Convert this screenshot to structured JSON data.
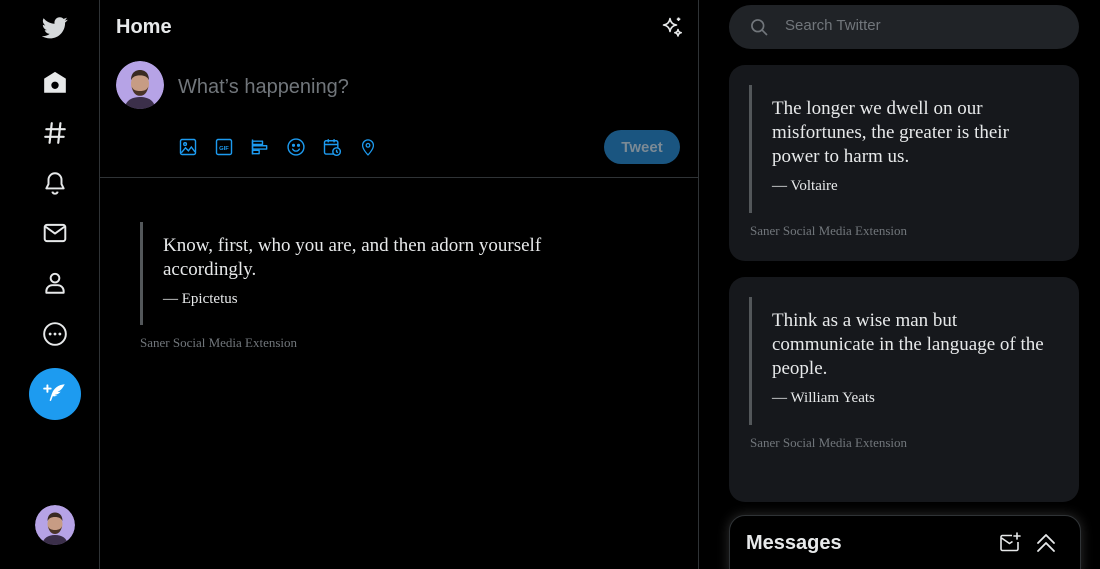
{
  "nav": {
    "items": [
      {
        "name": "twitter-logo-icon"
      },
      {
        "name": "home-icon"
      },
      {
        "name": "explore-hashtag-icon"
      },
      {
        "name": "notifications-bell-icon"
      },
      {
        "name": "messages-envelope-icon"
      },
      {
        "name": "profile-person-icon"
      },
      {
        "name": "more-circle-icon"
      }
    ],
    "compose_icon": "compose-feather-icon",
    "accent_color": "#1d9bf0"
  },
  "header": {
    "title": "Home",
    "sparkle_icon": "sparkle-icon"
  },
  "composer": {
    "placeholder": "What’s happening?",
    "tools": [
      "image-icon",
      "gif-icon",
      "poll-icon",
      "emoji-icon",
      "schedule-icon",
      "location-icon"
    ],
    "gif_label": "GIF",
    "tweet_label": "Tweet"
  },
  "main_quote": {
    "text": "Know, first, who you are, and then adorn yourself accordingly.",
    "author": "— Epictetus",
    "source": "Saner Social Media Extension"
  },
  "search": {
    "placeholder": "Search Twitter"
  },
  "sidebar_quotes": [
    {
      "text": "The longer we dwell on our misfortunes, the greater is their power to harm us.",
      "author": "— Voltaire",
      "source": "Saner Social Media Extension"
    },
    {
      "text": "Think as a wise man but communicate in the language of the people.",
      "author": "— William Yeats",
      "source": "Saner Social Media Extension"
    }
  ],
  "messages": {
    "title": "Messages",
    "new_message_icon": "new-message-icon",
    "collapse_icon": "double-chevron-up-icon"
  }
}
